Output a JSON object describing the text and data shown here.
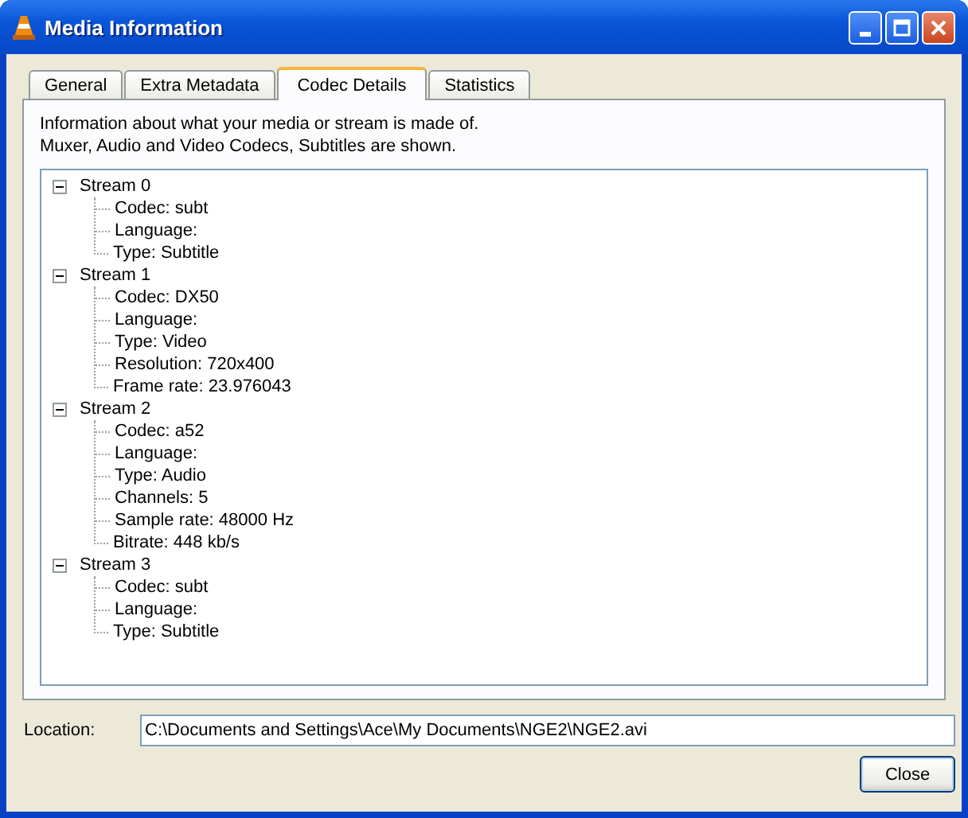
{
  "window": {
    "title": "Media Information"
  },
  "tabs": [
    {
      "label": "General",
      "selected": false
    },
    {
      "label": "Extra Metadata",
      "selected": false
    },
    {
      "label": "Codec Details",
      "selected": true
    },
    {
      "label": "Statistics",
      "selected": false
    }
  ],
  "description": [
    "Information about what your media or stream is made of.",
    "Muxer, Audio and Video Codecs, Subtitles are shown."
  ],
  "streams": [
    {
      "label": "Stream 0",
      "expanded": true,
      "children": [
        "Codec: subt",
        "Language:",
        "Type: Subtitle"
      ]
    },
    {
      "label": "Stream 1",
      "expanded": true,
      "children": [
        "Codec: DX50",
        "Language:",
        "Type: Video",
        "Resolution: 720x400",
        "Frame rate: 23.976043"
      ]
    },
    {
      "label": "Stream 2",
      "expanded": true,
      "children": [
        "Codec: a52",
        "Language:",
        "Type: Audio",
        "Channels: 5",
        "Sample rate: 48000 Hz",
        "Bitrate: 448 kb/s"
      ]
    },
    {
      "label": "Stream 3",
      "expanded": true,
      "children": [
        "Codec: subt",
        "Language:",
        "Type: Subtitle"
      ]
    }
  ],
  "location": {
    "label": "Location:",
    "value": "C:\\Documents and Settings\\Ace\\My Documents\\NGE2\\NGE2.avi"
  },
  "buttons": [
    "Close"
  ]
}
